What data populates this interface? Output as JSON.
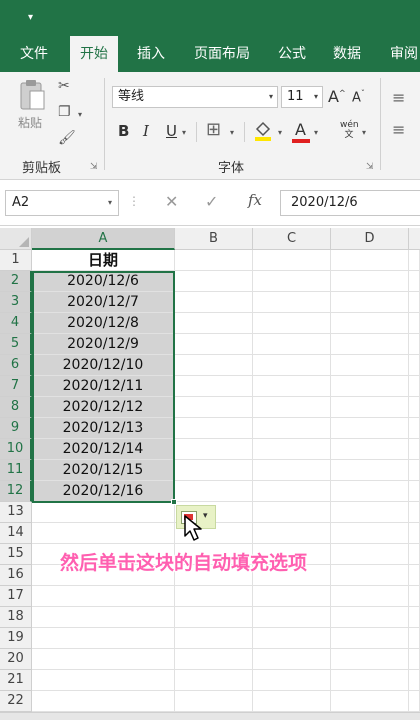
{
  "ribbon": {
    "tabs": [
      "文件",
      "开始",
      "插入",
      "页面布局",
      "公式",
      "数据",
      "审阅"
    ],
    "active_tab": "开始",
    "clipboard": {
      "paste_label": "粘贴",
      "group_label": "剪贴板"
    },
    "font": {
      "name": "等线",
      "size": "11",
      "group_label": "字体",
      "bold": "B",
      "italic": "I",
      "underline": "U",
      "grow": "A",
      "shrink": "A",
      "font_color_glyph": "A",
      "phonetic": "wén\n文"
    }
  },
  "formula_bar": {
    "name_box": "A2",
    "fx": "fx",
    "value": "2020/12/6"
  },
  "grid": {
    "columns": [
      "A",
      "B",
      "C",
      "D"
    ],
    "rows": [
      "1",
      "2",
      "3",
      "4",
      "5",
      "6",
      "7",
      "8",
      "9",
      "10",
      "11",
      "12",
      "13",
      "14",
      "15",
      "16",
      "17",
      "18",
      "19",
      "20",
      "21",
      "22"
    ],
    "column_a": [
      "日期",
      "2020/12/6",
      "2020/12/7",
      "2020/12/8",
      "2020/12/9",
      "2020/12/10",
      "2020/12/11",
      "2020/12/12",
      "2020/12/13",
      "2020/12/14",
      "2020/12/15",
      "2020/12/16"
    ]
  },
  "caption": "然后单击这块的自动填充选项",
  "colors": {
    "brand": "#217346",
    "caption": "#ff5fb0",
    "selection_fill": "#d3d3d3"
  },
  "icons": {
    "paste": "clipboard-icon",
    "cut": "scissors-icon",
    "copy": "copy-icon",
    "format_painter": "brush-icon",
    "borders": "grid-icon",
    "fill": "paint-bucket-icon",
    "auto_fill": "auto-fill-options-icon",
    "cursor": "pointer-cursor-icon"
  }
}
